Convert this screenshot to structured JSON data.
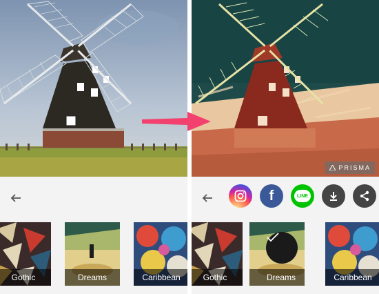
{
  "colors": {
    "accent_arrow": "#f2416f",
    "instagram": "#d6249f",
    "facebook": "#3b5998",
    "line": "#00c300",
    "download": "#444444",
    "share": "#444444"
  },
  "left_panel": {
    "filters": [
      {
        "label": "Gothic"
      },
      {
        "label": "Dreams"
      },
      {
        "label": "Caribbean"
      }
    ]
  },
  "right_panel": {
    "watermark": "PRISMA",
    "share_icons": [
      "instagram-icon",
      "facebook-icon",
      "line-icon",
      "download-icon",
      "share-icon"
    ],
    "line_text": "LINE",
    "facebook_letter": "f",
    "filters": [
      {
        "label": "Gothic"
      },
      {
        "label": "Dreams",
        "selected": true
      },
      {
        "label": "Caribbean"
      }
    ]
  }
}
